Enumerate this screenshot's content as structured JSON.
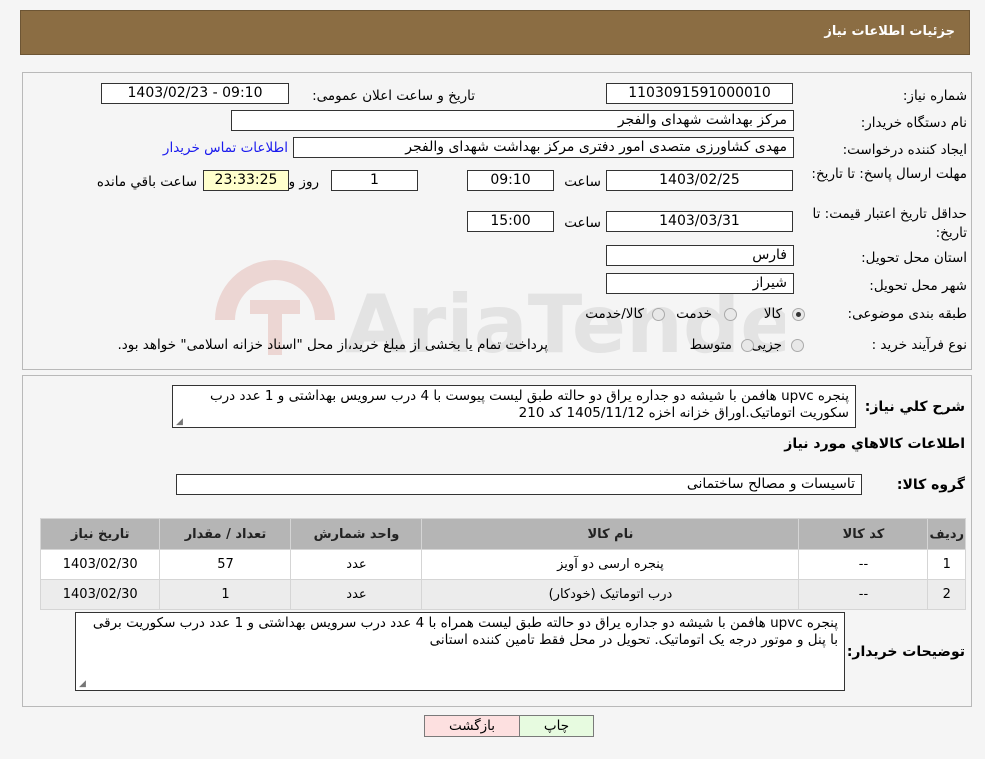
{
  "header": {
    "title": "جزئیات اطلاعات نیاز"
  },
  "form": {
    "need_number_label": "شماره نیاز:",
    "need_number": "1103091591000010",
    "announce_label": "تاریخ و ساعت اعلان عمومی:",
    "announce_value": "1403/02/23 - 09:10",
    "buyer_org_label": "نام دستگاه خریدار:",
    "buyer_org": "مرکز بهداشت شهدای والفجر",
    "creator_label": "ایجاد کننده درخواست:",
    "creator": "مهدی کشاورزی متصدی امور دفتری مرکز بهداشت شهدای والفجر",
    "contact_link": "اطلاعات تماس خریدار",
    "deadline_label": "مهلت ارسال پاسخ: تا تاریخ:",
    "deadline_date": "1403/02/25",
    "time_label": "ساعت",
    "deadline_time": "09:10",
    "days_value": "1",
    "days_label": "روز و",
    "remaining_time": "23:33:25",
    "remaining_label": "ساعت باقي مانده",
    "validity_label": "حداقل تاریخ اعتبار قیمت: تا تاریخ:",
    "validity_date": "1403/03/31",
    "validity_time": "15:00",
    "province_label": "استان محل تحویل:",
    "province": "فارس",
    "city_label": "شهر محل تحویل:",
    "city": "شیراز",
    "category_label": "طبقه بندی موضوعی:",
    "category_options": [
      "کالا",
      "خدمت",
      "کالا/خدمت"
    ],
    "category_selected": "کالا",
    "process_label": "نوع فرآیند خرید :",
    "process_options": [
      "جزیی",
      "متوسط"
    ],
    "process_note": "پرداخت تمام یا بخشی از مبلغ خرید،از محل \"اسناد خزانه اسلامی\" خواهد بود."
  },
  "summary": {
    "label": "شرح کلي نياز:",
    "text": "پنجره upvc هافمن با شیشه دو جداره یراق دو حالته طبق لیست پیوست با 4 درب سرویس بهداشتی و 1 عدد درب سکوریت اتوماتیک.اوراق خزانه اخزه 1405/11/12 کد 210"
  },
  "goods_section": {
    "title": "اطلاعات کالاهاي مورد نياز",
    "group_label": "گروه کالا:",
    "group_value": "تاسیسات و مصالح ساختمانی"
  },
  "table": {
    "headers": [
      "ردیف",
      "کد کالا",
      "نام کالا",
      "واحد شمارش",
      "تعداد / مقدار",
      "تاریخ نیاز"
    ],
    "rows": [
      [
        "1",
        "--",
        "پنجره ارسی دو آویز",
        "عدد",
        "57",
        "1403/02/30"
      ],
      [
        "2",
        "--",
        "درب اتوماتیک (خودکار)",
        "عدد",
        "1",
        "1403/02/30"
      ]
    ]
  },
  "buyer_notes": {
    "label": "توضیحات خریدار:",
    "text": "پنجره upvc هافمن با شیشه دو جداره یراق دو حالته طبق لیست همراه با 4 عدد درب سرویس بهداشتی و 1 عدد درب سکوریت برقی با پنل و موتور درجه یک اتوماتیک. تحویل در محل فقط تامین کننده استانی"
  },
  "buttons": {
    "print": "چاپ",
    "back": "بازگشت"
  },
  "watermark": {
    "text": "AriaTender.neT"
  },
  "colors": {
    "header_bg": "#8b6d43",
    "link": "#1a1aee",
    "back_bg": "#fde0e0",
    "print_bg": "#e7fbe0"
  }
}
